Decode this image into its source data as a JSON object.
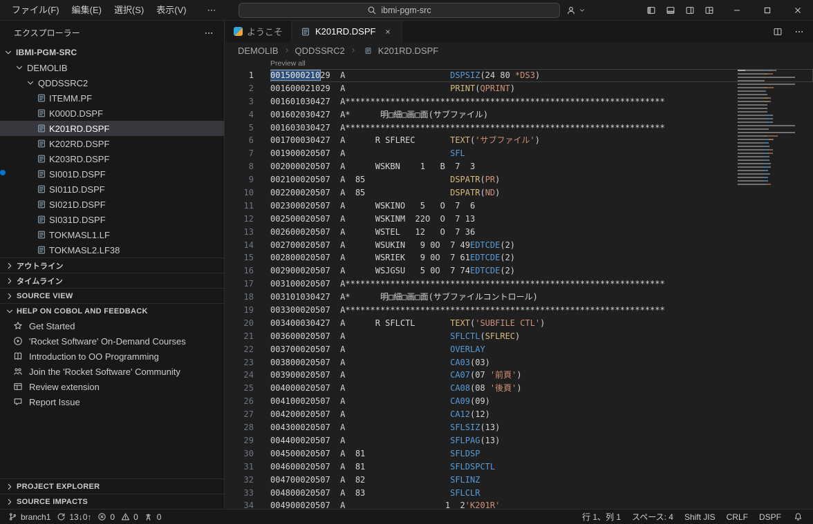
{
  "colors": {
    "accent": "#0078d4",
    "keyword_blue": "#569cd6",
    "function_yellow": "#d7ba7d",
    "string_orange": "#ce9178",
    "plain": "#d4d4d4",
    "selection": "#2d4f78"
  },
  "titlebar": {
    "menus": [
      "ファイル(F)",
      "編集(E)",
      "選択(S)",
      "表示(V)"
    ],
    "menu_more": "⋯",
    "search": {
      "value": "ibmi-pgm-src"
    },
    "layout_icons": [
      "layout-sidebar-left",
      "layout-panel",
      "layout-sidebar-right",
      "layout-custom"
    ],
    "window_controls": [
      "minimize",
      "maximize",
      "close"
    ]
  },
  "sidebar": {
    "title": "エクスプローラー",
    "tree": [
      {
        "label": "IBMI-PGM-SRC",
        "depth": 0,
        "kind": "folder",
        "expanded": true
      },
      {
        "label": "DEMOLIB",
        "depth": 1,
        "kind": "folder",
        "expanded": true
      },
      {
        "label": "QDDSSRC2",
        "depth": 2,
        "kind": "folder",
        "expanded": true
      },
      {
        "label": "ITEMM.PF",
        "depth": 3,
        "kind": "file"
      },
      {
        "label": "K000D.DSPF",
        "depth": 3,
        "kind": "file"
      },
      {
        "label": "K201RD.DSPF",
        "depth": 3,
        "kind": "file",
        "selected": true
      },
      {
        "label": "K202RD.DSPF",
        "depth": 3,
        "kind": "file"
      },
      {
        "label": "K203RD.DSPF",
        "depth": 3,
        "kind": "file"
      },
      {
        "label": "SI001D.DSPF",
        "depth": 3,
        "kind": "file"
      },
      {
        "label": "SI011D.DSPF",
        "depth": 3,
        "kind": "file"
      },
      {
        "label": "SI021D.DSPF",
        "depth": 3,
        "kind": "file"
      },
      {
        "label": "SI031D.DSPF",
        "depth": 3,
        "kind": "file"
      },
      {
        "label": "TOKMASL1.LF",
        "depth": 3,
        "kind": "file"
      },
      {
        "label": "TOKMASL2.LF38",
        "depth": 3,
        "kind": "file"
      }
    ],
    "sections": [
      {
        "label": "アウトライン",
        "expanded": false
      },
      {
        "label": "タイムライン",
        "expanded": false
      },
      {
        "label": "SOURCE VIEW",
        "expanded": false
      },
      {
        "label": "HELP ON COBOL AND FEEDBACK",
        "expanded": true
      }
    ],
    "help_items": [
      {
        "label": "Get Started",
        "icon": "star"
      },
      {
        "label": "'Rocket Software' On-Demand Courses",
        "icon": "play-circle"
      },
      {
        "label": "Introduction to OO Programming",
        "icon": "book"
      },
      {
        "label": "Join the 'Rocket Software' Community",
        "icon": "organization"
      },
      {
        "label": "Review extension",
        "icon": "preview"
      },
      {
        "label": "Report Issue",
        "icon": "comment"
      }
    ],
    "bottom_sections": [
      {
        "label": "PROJECT EXPLORER"
      },
      {
        "label": "SOURCE IMPACTS"
      }
    ]
  },
  "editor": {
    "tabs": [
      {
        "label": "ようこそ",
        "active": false,
        "icon": "welcome"
      },
      {
        "label": "K201RD.DSPF",
        "active": true,
        "icon": "file"
      }
    ],
    "breadcrumb": [
      "DEMOLIB",
      "QDDSSRC2",
      "K201RD.DSPF"
    ],
    "codelens": "Preview all",
    "lines": [
      {
        "n": 1,
        "cur": true,
        "segs": [
          [
            "0015000210",
            "sel"
          ],
          [
            "29",
            "p"
          ],
          [
            "  A                     ",
            "p"
          ],
          [
            "DSPSIZ",
            "b"
          ],
          [
            "(24 80 ",
            "p"
          ],
          [
            "*DS3",
            "o"
          ],
          [
            ")",
            "p"
          ]
        ]
      },
      {
        "n": 2,
        "segs": [
          [
            "001600021029  A                     ",
            "p"
          ],
          [
            "PRINT",
            "y"
          ],
          [
            "(",
            "p"
          ],
          [
            "QPRINT",
            "o"
          ],
          [
            ")",
            "p"
          ]
        ]
      },
      {
        "n": 3,
        "segs": [
          [
            "001601030427  A",
            "p"
          ],
          [
            "****************************************************************",
            "p"
          ]
        ]
      },
      {
        "n": 4,
        "segs": [
          [
            "001602030427  A*      明□細□画□面(サブファイル)",
            "p"
          ]
        ]
      },
      {
        "n": 5,
        "segs": [
          [
            "001603030427  A",
            "p"
          ],
          [
            "****************************************************************",
            "p"
          ]
        ]
      },
      {
        "n": 6,
        "segs": [
          [
            "001700030427  A      R SFLREC       ",
            "p"
          ],
          [
            "TEXT",
            "y"
          ],
          [
            "(",
            "p"
          ],
          [
            "'サブファイル'",
            "o"
          ],
          [
            ")",
            "p"
          ]
        ]
      },
      {
        "n": 7,
        "segs": [
          [
            "001900020507  A                     ",
            "p"
          ],
          [
            "SFL",
            "b"
          ]
        ]
      },
      {
        "n": 8,
        "segs": [
          [
            "002000020507  A      WSKBN    1   B  7  3",
            "p"
          ]
        ]
      },
      {
        "n": 9,
        "segs": [
          [
            "002100020507  A  85                 ",
            "p"
          ],
          [
            "DSPATR",
            "y"
          ],
          [
            "(",
            "p"
          ],
          [
            "PR",
            "o"
          ],
          [
            ")",
            "p"
          ]
        ]
      },
      {
        "n": 10,
        "segs": [
          [
            "002200020507  A  85                 ",
            "p"
          ],
          [
            "DSPATR",
            "y"
          ],
          [
            "(",
            "p"
          ],
          [
            "ND",
            "o"
          ],
          [
            ")",
            "p"
          ]
        ]
      },
      {
        "n": 11,
        "segs": [
          [
            "002300020507  A      WSKINO   5   O  7  6",
            "p"
          ]
        ]
      },
      {
        "n": 12,
        "segs": [
          [
            "002500020507  A      WSKINM  22O  O  7 13",
            "p"
          ]
        ]
      },
      {
        "n": 13,
        "segs": [
          [
            "002600020507  A      WSTEL   12   O  7 36",
            "p"
          ]
        ]
      },
      {
        "n": 14,
        "segs": [
          [
            "002700020507  A      WSUKIN   9 0O  7 49",
            "p"
          ],
          [
            "EDTCDE",
            "b"
          ],
          [
            "(2)",
            "p"
          ]
        ]
      },
      {
        "n": 15,
        "segs": [
          [
            "002800020507  A      WSRIEK   9 0O  7 61",
            "p"
          ],
          [
            "EDTCDE",
            "b"
          ],
          [
            "(2)",
            "p"
          ]
        ]
      },
      {
        "n": 16,
        "segs": [
          [
            "002900020507  A      WSJGSU   5 0O  7 74",
            "p"
          ],
          [
            "EDTCDE",
            "b"
          ],
          [
            "(2)",
            "p"
          ]
        ]
      },
      {
        "n": 17,
        "segs": [
          [
            "003100020507  A",
            "p"
          ],
          [
            "****************************************************************",
            "p"
          ]
        ]
      },
      {
        "n": 18,
        "segs": [
          [
            "003101030427  A*      明□細□画□面(サブファイルコントロール)",
            "p"
          ]
        ]
      },
      {
        "n": 19,
        "segs": [
          [
            "003300020507  A",
            "p"
          ],
          [
            "****************************************************************",
            "p"
          ]
        ]
      },
      {
        "n": 20,
        "segs": [
          [
            "003400030427  A      R SFLCTL       ",
            "p"
          ],
          [
            "TEXT",
            "y"
          ],
          [
            "(",
            "p"
          ],
          [
            "'SUBFILE CTL'",
            "o"
          ],
          [
            ")",
            "p"
          ]
        ]
      },
      {
        "n": 21,
        "segs": [
          [
            "003600020507  A                     ",
            "p"
          ],
          [
            "SFLCTL",
            "b"
          ],
          [
            "(",
            "p"
          ],
          [
            "SFLREC",
            "y"
          ],
          [
            ")",
            "p"
          ]
        ]
      },
      {
        "n": 22,
        "segs": [
          [
            "003700020507  A                     ",
            "p"
          ],
          [
            "OVERLAY",
            "b"
          ]
        ]
      },
      {
        "n": 23,
        "segs": [
          [
            "003800020507  A                     ",
            "p"
          ],
          [
            "CA03",
            "b"
          ],
          [
            "(03)",
            "p"
          ]
        ]
      },
      {
        "n": 24,
        "segs": [
          [
            "003900020507  A                     ",
            "p"
          ],
          [
            "CA07",
            "b"
          ],
          [
            "(07 ",
            "p"
          ],
          [
            "'前頁'",
            "o"
          ],
          [
            ")",
            "p"
          ]
        ]
      },
      {
        "n": 25,
        "segs": [
          [
            "004000020507  A                     ",
            "p"
          ],
          [
            "CA08",
            "b"
          ],
          [
            "(08 ",
            "p"
          ],
          [
            "'後頁'",
            "o"
          ],
          [
            ")",
            "p"
          ]
        ]
      },
      {
        "n": 26,
        "segs": [
          [
            "004100020507  A                     ",
            "p"
          ],
          [
            "CA09",
            "b"
          ],
          [
            "(09)",
            "p"
          ]
        ]
      },
      {
        "n": 27,
        "segs": [
          [
            "004200020507  A                     ",
            "p"
          ],
          [
            "CA12",
            "b"
          ],
          [
            "(12)",
            "p"
          ]
        ]
      },
      {
        "n": 28,
        "segs": [
          [
            "004300020507  A                     ",
            "p"
          ],
          [
            "SFLSIZ",
            "b"
          ],
          [
            "(13)",
            "p"
          ]
        ]
      },
      {
        "n": 29,
        "segs": [
          [
            "004400020507  A                     ",
            "p"
          ],
          [
            "SFLPAG",
            "b"
          ],
          [
            "(13)",
            "p"
          ]
        ]
      },
      {
        "n": 30,
        "segs": [
          [
            "004500020507  A  81                 ",
            "p"
          ],
          [
            "SFLDSP",
            "b"
          ]
        ]
      },
      {
        "n": 31,
        "segs": [
          [
            "004600020507  A  81                 ",
            "p"
          ],
          [
            "SFLDSPCTL",
            "b"
          ]
        ]
      },
      {
        "n": 32,
        "segs": [
          [
            "004700020507  A  82                 ",
            "p"
          ],
          [
            "SFLINZ",
            "b"
          ]
        ]
      },
      {
        "n": 33,
        "segs": [
          [
            "004800020507  A  83                 ",
            "p"
          ],
          [
            "SFLCLR",
            "b"
          ]
        ]
      },
      {
        "n": 34,
        "segs": [
          [
            "004900020507  A                    1  2",
            "p"
          ],
          [
            "'K201R'",
            "o"
          ]
        ]
      }
    ]
  },
  "statusbar": {
    "left": [
      {
        "name": "branch",
        "icon": "git-branch",
        "label": "branch1"
      },
      {
        "name": "sync",
        "icon": "sync",
        "label": "13↓0↑"
      },
      {
        "name": "errors",
        "icon": "error",
        "label": "0"
      },
      {
        "name": "warnings",
        "icon": "warning",
        "label": "0"
      },
      {
        "name": "broadcast",
        "icon": "tower",
        "label": "0"
      }
    ],
    "right": [
      {
        "name": "cursor-position",
        "label": "行 1、列 1"
      },
      {
        "name": "indentation",
        "label": "スペース: 4"
      },
      {
        "name": "encoding",
        "label": "Shift JIS"
      },
      {
        "name": "eol",
        "label": "CRLF"
      },
      {
        "name": "language-mode",
        "label": "DSPF"
      },
      {
        "name": "notifications",
        "icon": "bell",
        "label": ""
      }
    ]
  }
}
